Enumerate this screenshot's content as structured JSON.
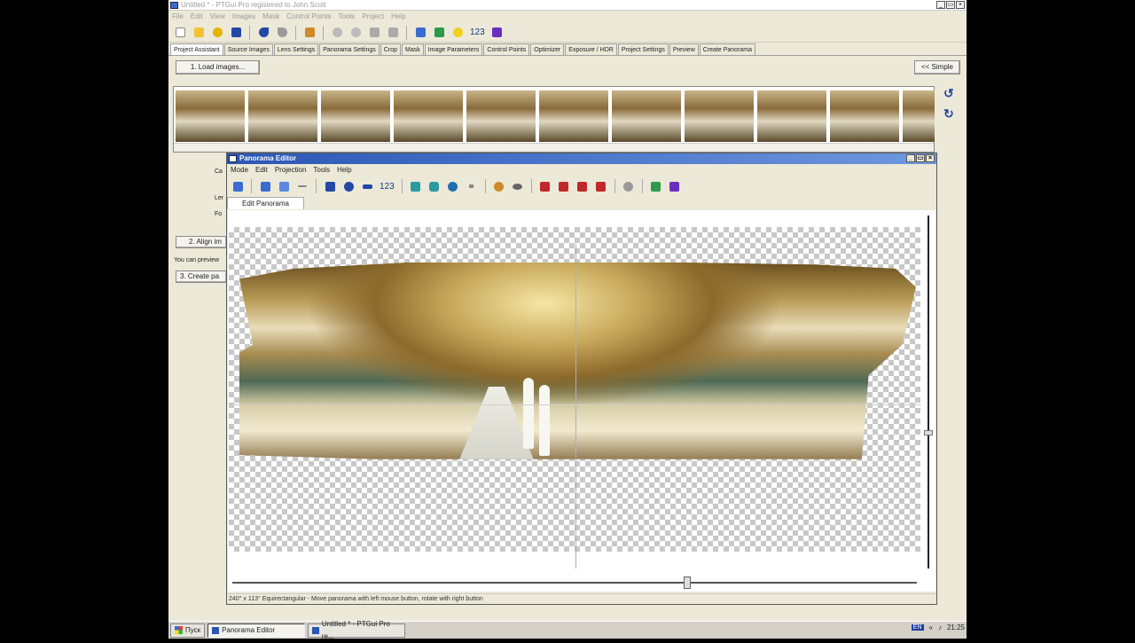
{
  "app": {
    "title": "Untitled * - PTGui Pro registered to John Scott",
    "window_buttons": [
      "_",
      "▭",
      "×"
    ],
    "menu": [
      "File",
      "Edit",
      "View",
      "Images",
      "Mask",
      "Control Points",
      "Tools",
      "Project",
      "Help"
    ],
    "toolbar_number": "123",
    "tabs": [
      "Project Assistant",
      "Source Images",
      "Lens Settings",
      "Panorama Settings",
      "Crop",
      "Mask",
      "Image Parameters",
      "Control Points",
      "Optimizer",
      "Exposure / HDR",
      "Project Settings",
      "Preview",
      "Create Panorama"
    ],
    "load_images_button": "1. Load images...",
    "simple_button": "<< Simple",
    "align_button": "2. Align im",
    "preview_text": "You can preview",
    "create_button": "3. Create pa",
    "side_label_1": "Ca",
    "side_label_2": "Ler",
    "side_label_3": "Fo"
  },
  "editor": {
    "title": "Panorama Editor",
    "menu": [
      "Mode",
      "Edit",
      "Projection",
      "Tools",
      "Help"
    ],
    "toolbar_number": "123",
    "tab": "Edit Panorama",
    "status": "240° x 113° Equirectangular - Move panorama with left mouse button, rotate with right button"
  },
  "taskbar": {
    "start": "Пуск",
    "items": [
      "Panorama Editor",
      "Untitled * - PTGui Pro re..."
    ],
    "lang": "EN",
    "clock": "21:25"
  },
  "colors": {
    "accent": "#2a56b5",
    "toolbar_icon": "#2347a6"
  }
}
